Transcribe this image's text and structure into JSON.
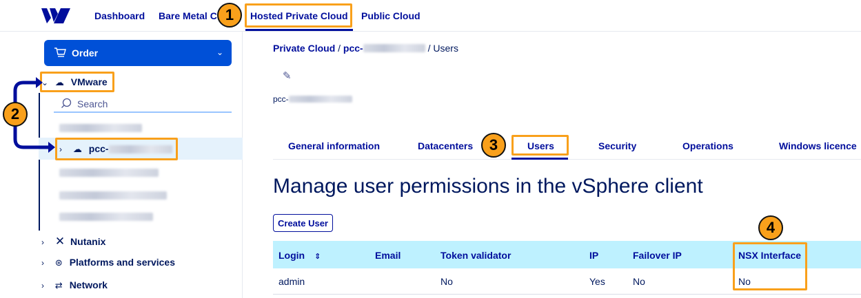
{
  "nav": {
    "links": [
      "Dashboard",
      "Bare Metal C",
      "Hosted Private Cloud",
      "Public Cloud"
    ]
  },
  "sidebar": {
    "order_label": "Order",
    "vmware_label": "VMware",
    "search_placeholder": "Search",
    "selected_item_prefix": "pcc-",
    "groups": [
      "Nutanix",
      "Platforms and services",
      "Network"
    ]
  },
  "main": {
    "breadcrumb": {
      "root": "Private Cloud",
      "sep": "/",
      "item_prefix": "pcc-",
      "current": "Users"
    },
    "pcc_prefix": "pcc-",
    "tabs": [
      "General information",
      "Datacenters",
      "Users",
      "Security",
      "Operations",
      "Windows licence"
    ],
    "active_tab": "Users",
    "heading": "Manage user permissions in the vSphere client",
    "create_user_label": "Create User",
    "table": {
      "columns": [
        "Login",
        "Email",
        "Token validator",
        "IP",
        "Failover IP",
        "NSX Interface"
      ],
      "sort_icon": "⇕",
      "rows": [
        {
          "login": "admin",
          "email": "",
          "token": "No",
          "ip": "Yes",
          "failover": "No",
          "nsx": "No"
        }
      ]
    }
  },
  "annotations": {
    "badges": [
      "1",
      "2",
      "3",
      "4"
    ],
    "color": "#f9a01b"
  },
  "colors": {
    "brand": "#000e9c",
    "primary_button": "#0050d7",
    "table_header": "#bef1ff",
    "selected_row": "#e5f2fc"
  }
}
